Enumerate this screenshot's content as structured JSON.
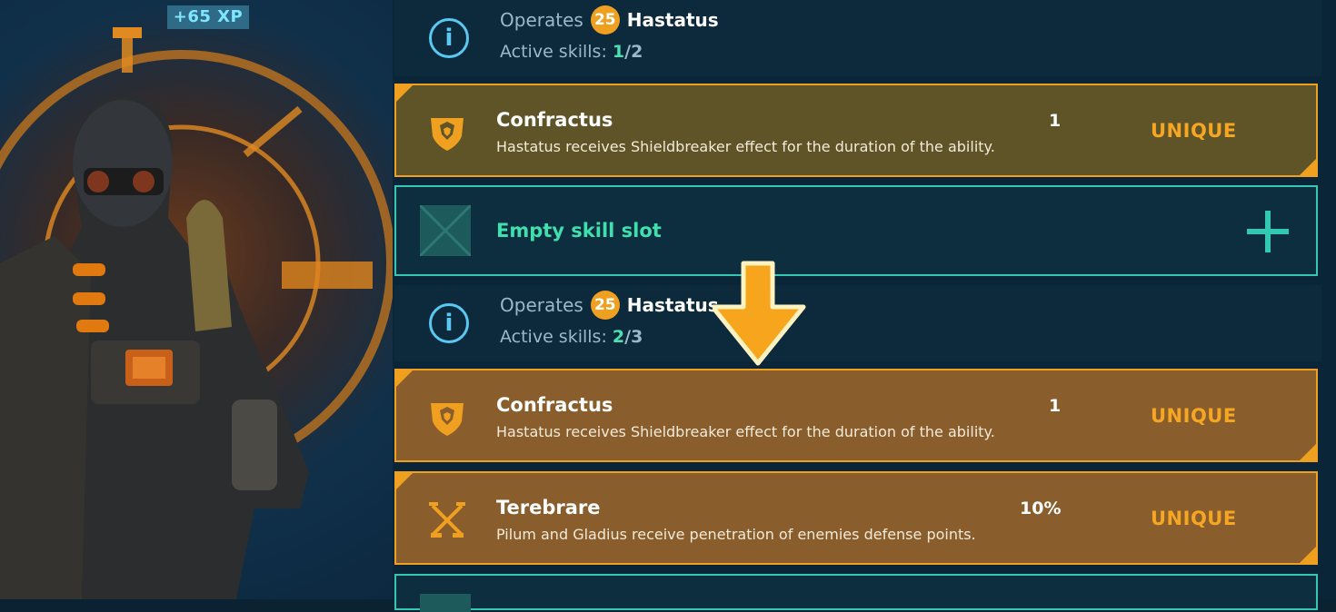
{
  "xp_badge": "+65 XP",
  "colors": {
    "accent_orange": "#f0a020",
    "accent_teal": "#32c8b4",
    "skill_count_green": "#4de0b0",
    "rarity_orange": "#f5a623"
  },
  "before": {
    "info": {
      "operates_label": "Operates",
      "level": "25",
      "hero": "Hastatus",
      "active_skills_label": "Active skills:",
      "active_count": "1",
      "active_total": "/2"
    },
    "skills": [
      {
        "name": "Confractus",
        "description": "Hastatus receives Shieldbreaker effect for the duration of the ability.",
        "level": "1",
        "rarity": "UNIQUE",
        "icon": "shield-shatter-icon"
      }
    ],
    "empty_slot": {
      "label": "Empty skill slot",
      "icon": "empty-slot-icon",
      "add_icon": "plus-icon"
    }
  },
  "after": {
    "info": {
      "operates_label": "Operates",
      "level": "25",
      "hero": "Hastatus",
      "active_skills_label": "Active skills:",
      "active_count": "2",
      "active_total": "/3"
    },
    "skills": [
      {
        "name": "Confractus",
        "description": "Hastatus receives Shieldbreaker effect for the duration of the ability.",
        "level": "1",
        "rarity": "UNIQUE",
        "icon": "shield-shatter-icon"
      },
      {
        "name": "Terebrare",
        "description": "Pilum and Gladius receive penetration of enemies defense points.",
        "level": "10%",
        "rarity": "UNIQUE",
        "icon": "crossed-swords-icon"
      }
    ]
  }
}
